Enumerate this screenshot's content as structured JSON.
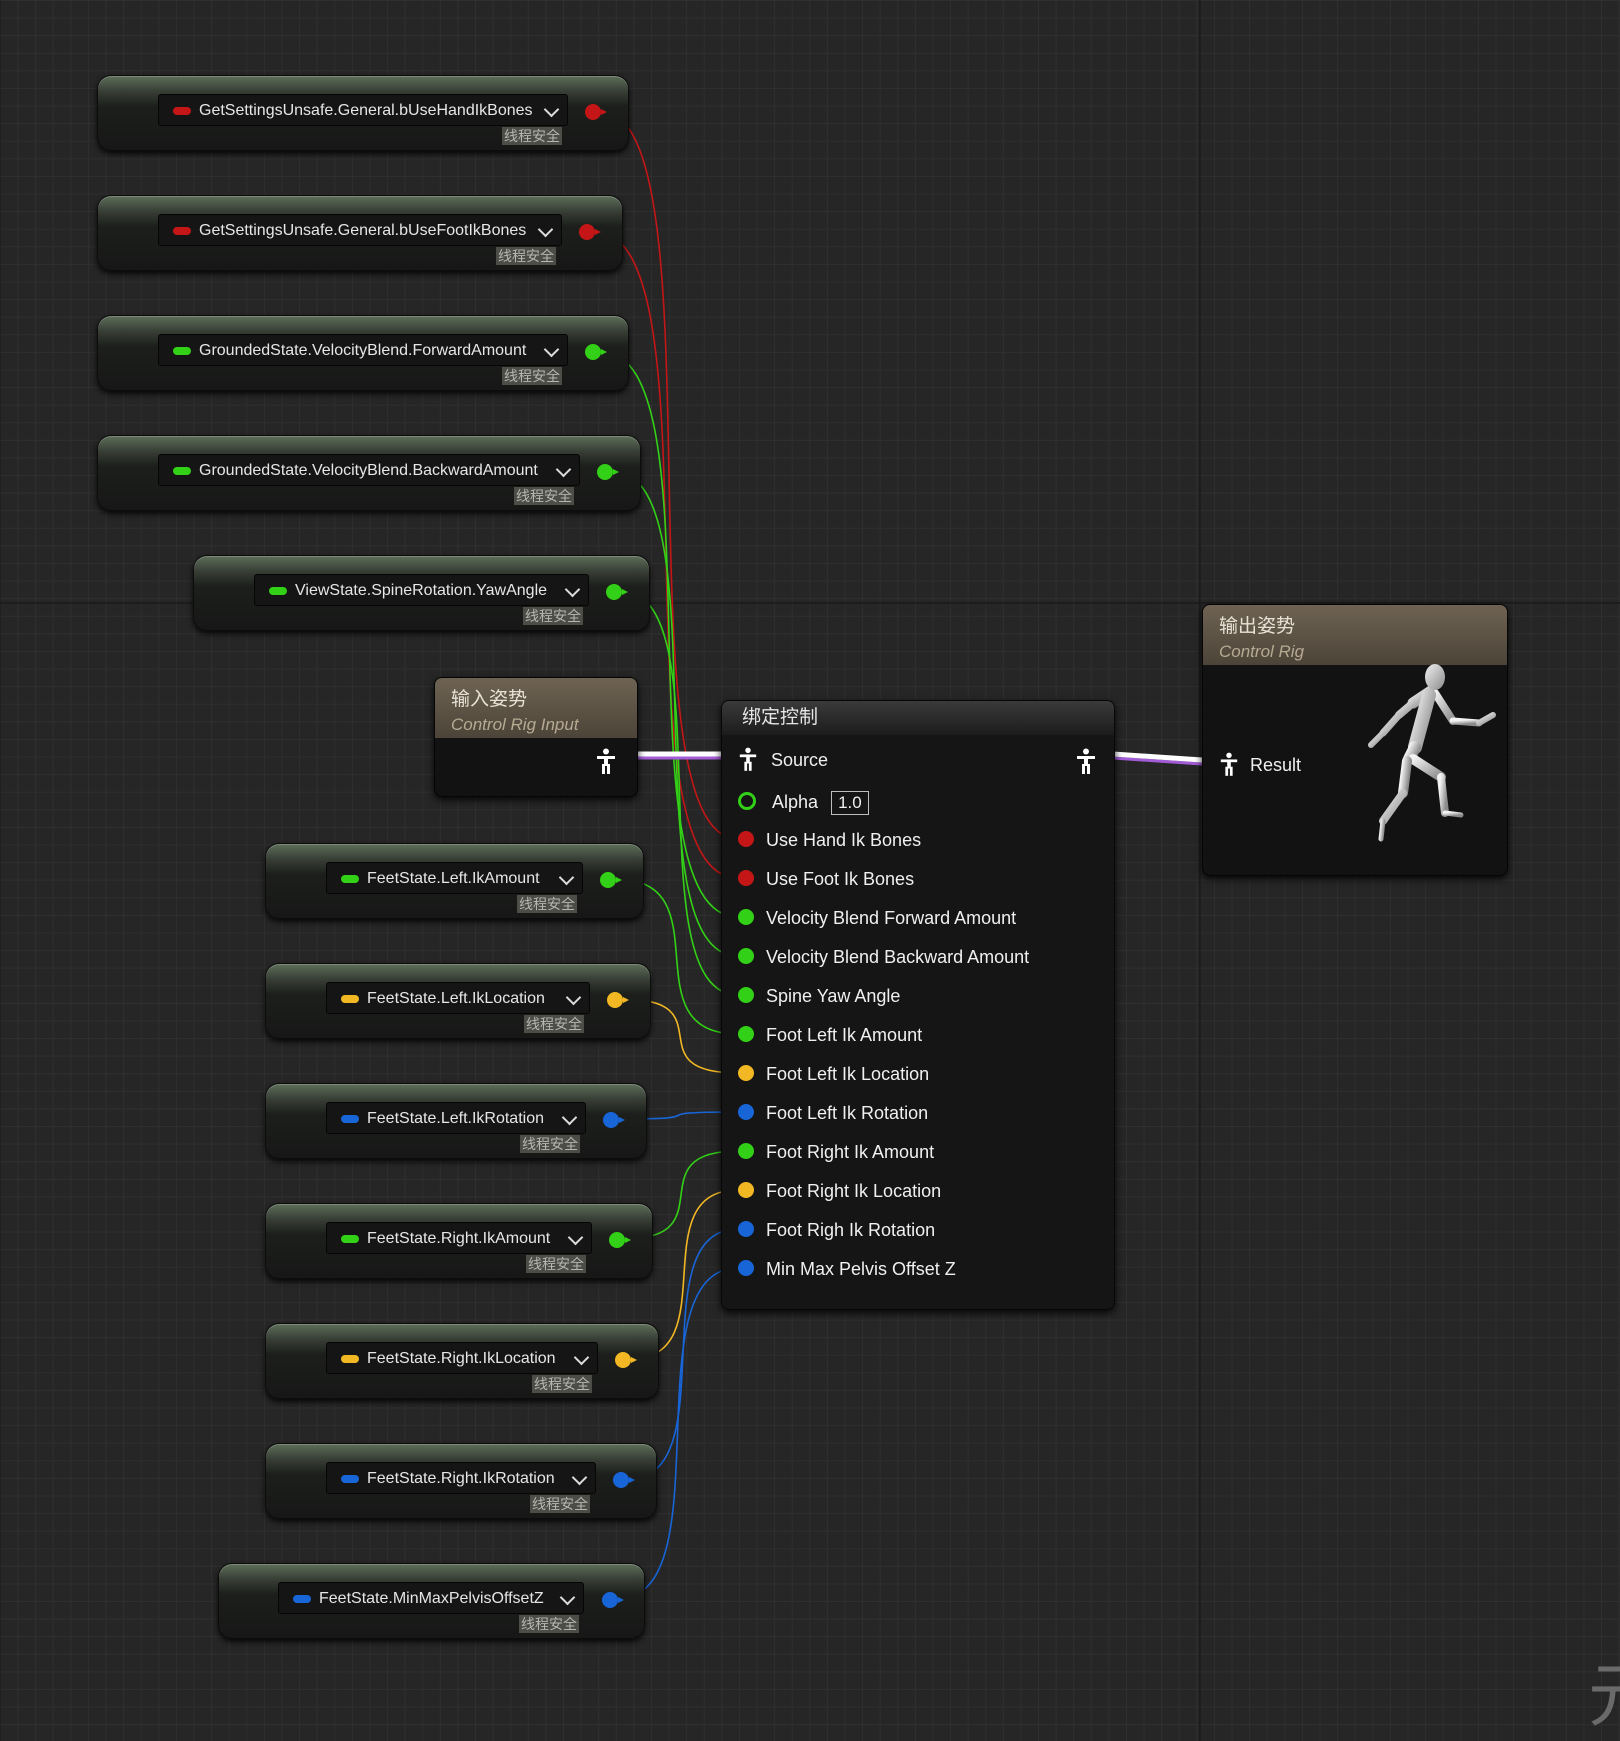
{
  "colors": {
    "bool_pin": "#c41616",
    "float_pin": "#32d016",
    "vector_pin": "#f2b824",
    "rotator_pin": "#1865d8",
    "pose_wire": "#ffffff",
    "pose_wire_accent": "#a35cd8"
  },
  "variable_nodes": [
    {
      "name": "GetSettingsUnsafe.General.bUseHandIkBones",
      "pin_type": "bool",
      "tag": "线程安全"
    },
    {
      "name": "GetSettingsUnsafe.General.bUseFootIkBones",
      "pin_type": "bool",
      "tag": "线程安全"
    },
    {
      "name": "GroundedState.VelocityBlend.ForwardAmount",
      "pin_type": "float",
      "tag": "线程安全"
    },
    {
      "name": "GroundedState.VelocityBlend.BackwardAmount",
      "pin_type": "float",
      "tag": "线程安全"
    },
    {
      "name": "ViewState.SpineRotation.YawAngle",
      "pin_type": "float",
      "tag": "线程安全"
    },
    {
      "name": "FeetState.Left.IkAmount",
      "pin_type": "float",
      "tag": "线程安全"
    },
    {
      "name": "FeetState.Left.IkLocation",
      "pin_type": "vector",
      "tag": "线程安全"
    },
    {
      "name": "FeetState.Left.IkRotation",
      "pin_type": "rotator",
      "tag": "线程安全"
    },
    {
      "name": "FeetState.Right.IkAmount",
      "pin_type": "float",
      "tag": "线程安全"
    },
    {
      "name": "FeetState.Right.IkLocation",
      "pin_type": "vector",
      "tag": "线程安全"
    },
    {
      "name": "FeetState.Right.IkRotation",
      "pin_type": "rotator",
      "tag": "线程安全"
    },
    {
      "name": "FeetState.MinMaxPelvisOffsetZ",
      "pin_type": "rotator",
      "tag": "线程安全"
    }
  ],
  "input_pose_node": {
    "title": "输入姿势",
    "subtitle": "Control Rig Input"
  },
  "output_pose_node": {
    "title": "输出姿势",
    "subtitle": "Control Rig",
    "result_label": "Result"
  },
  "control_rig_node": {
    "title": "绑定控制",
    "source_label": "Source",
    "alpha_label": "Alpha",
    "alpha_value": "1.0",
    "pins": [
      {
        "label": "Use Hand Ik Bones",
        "pin_type": "bool"
      },
      {
        "label": "Use Foot Ik Bones",
        "pin_type": "bool"
      },
      {
        "label": "Velocity Blend Forward Amount",
        "pin_type": "float"
      },
      {
        "label": "Velocity Blend Backward Amount",
        "pin_type": "float"
      },
      {
        "label": "Spine Yaw Angle",
        "pin_type": "float"
      },
      {
        "label": "Foot Left Ik Amount",
        "pin_type": "float"
      },
      {
        "label": "Foot Left Ik Location",
        "pin_type": "vector"
      },
      {
        "label": "Foot Left Ik Rotation",
        "pin_type": "rotator"
      },
      {
        "label": "Foot Right Ik Amount",
        "pin_type": "float"
      },
      {
        "label": "Foot Right Ik Location",
        "pin_type": "vector"
      },
      {
        "label": "Foot Righ Ik Rotation",
        "pin_type": "rotator"
      },
      {
        "label": "Min Max Pelvis Offset Z",
        "pin_type": "rotator"
      }
    ]
  },
  "watermark_glyph": "元"
}
